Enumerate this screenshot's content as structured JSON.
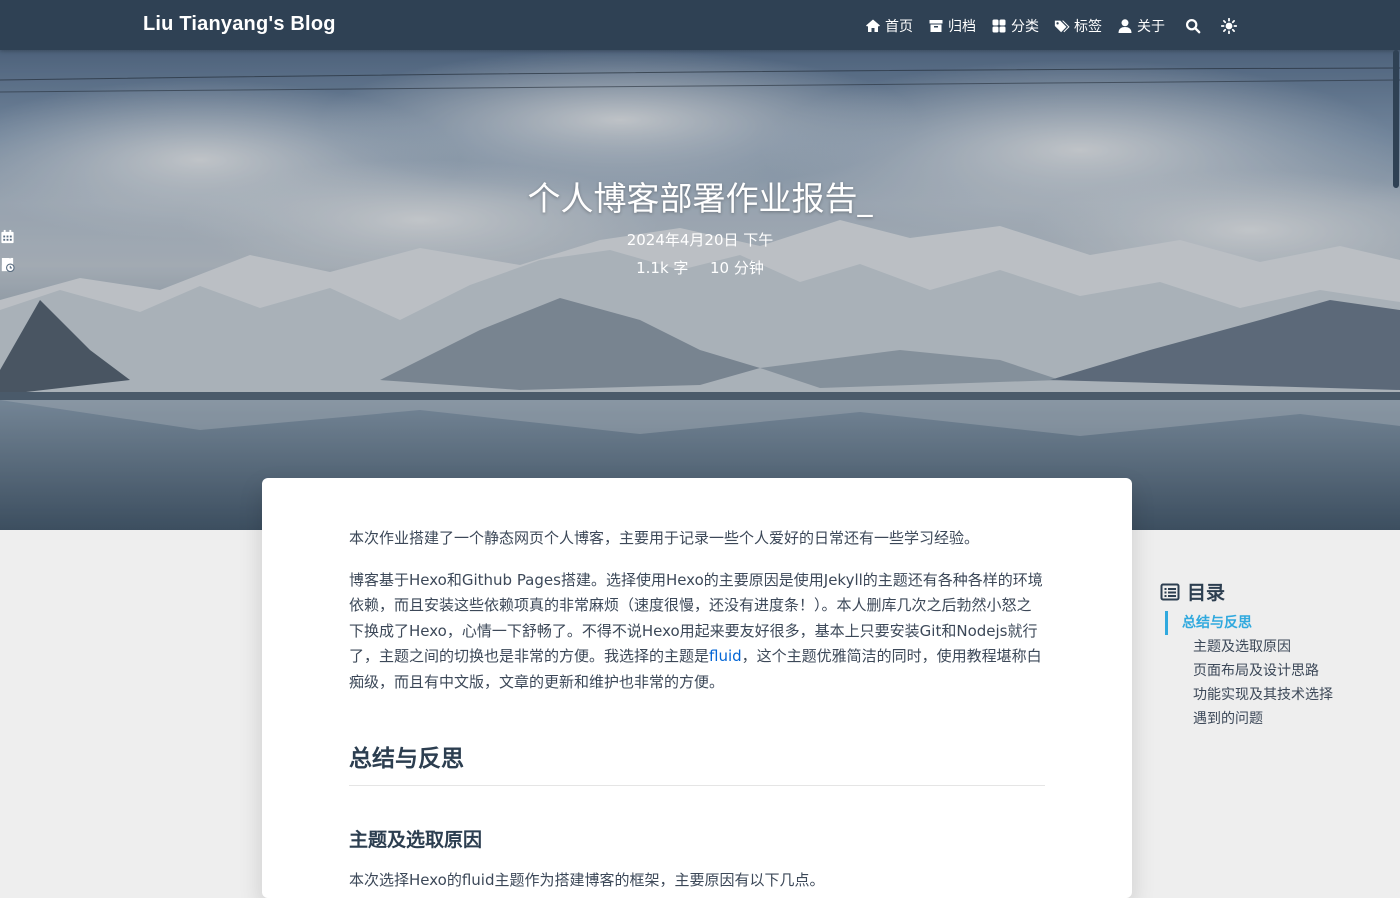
{
  "site": {
    "brand": "Liu Tianyang's Blog"
  },
  "nav": {
    "items": [
      {
        "icon": "home-icon",
        "label": "首页"
      },
      {
        "icon": "archive-icon",
        "label": "归档"
      },
      {
        "icon": "category-icon",
        "label": "分类"
      },
      {
        "icon": "tags-icon",
        "label": "标签"
      },
      {
        "icon": "user-icon",
        "label": "关于"
      }
    ],
    "search_icon": "search-icon",
    "theme_icon": "sun-icon"
  },
  "banner": {
    "title": "个人博客部署作业报告",
    "cursor": "_",
    "date": "2024年4月20日 下午",
    "wordcount": "1.1k 字",
    "readtime": "10 分钟"
  },
  "article": {
    "p1": "本次作业搭建了一个静态网页个人博客，主要用于记录一些个人爱好的日常还有一些学习经验。",
    "p2_before": "博客基于Hexo和Github Pages搭建。选择使用Hexo的主要原因是使用Jekyll的主题还有各种各样的环境依赖，而且安装这些依赖项真的非常麻烦（速度很慢，还没有进度条！）。本人删库几次之后勃然小怒之下换成了Hexo，心情一下舒畅了。不得不说Hexo用起来要友好很多，基本上只要安装Git和Nodejs就行了，主题之间的切换也是非常的方便。我选择的主题是",
    "p2_link": "fluid",
    "p2_after": "，这个主题优雅简洁的同时，使用教程堪称白痴级，而且有中文版，文章的更新和维护也非常的方便。",
    "h2": "总结与反思",
    "h3": "主题及选取原因",
    "p3_partial": "本次选择Hexo的fluid主题作为搭建博客的框架，主要原因有以下几点。"
  },
  "toc": {
    "title": "目录",
    "items": [
      {
        "label": "总结与反思",
        "active": true
      },
      {
        "label": "主题及选取原因"
      },
      {
        "label": "页面布局及设计思路"
      },
      {
        "label": "功能实现及其技术选择"
      },
      {
        "label": "遇到的问题"
      }
    ]
  },
  "colors": {
    "navbar": "#2f4154",
    "link": "#0366d6",
    "toc_active": "#30a9de",
    "page_bg": "#eeeeee"
  }
}
